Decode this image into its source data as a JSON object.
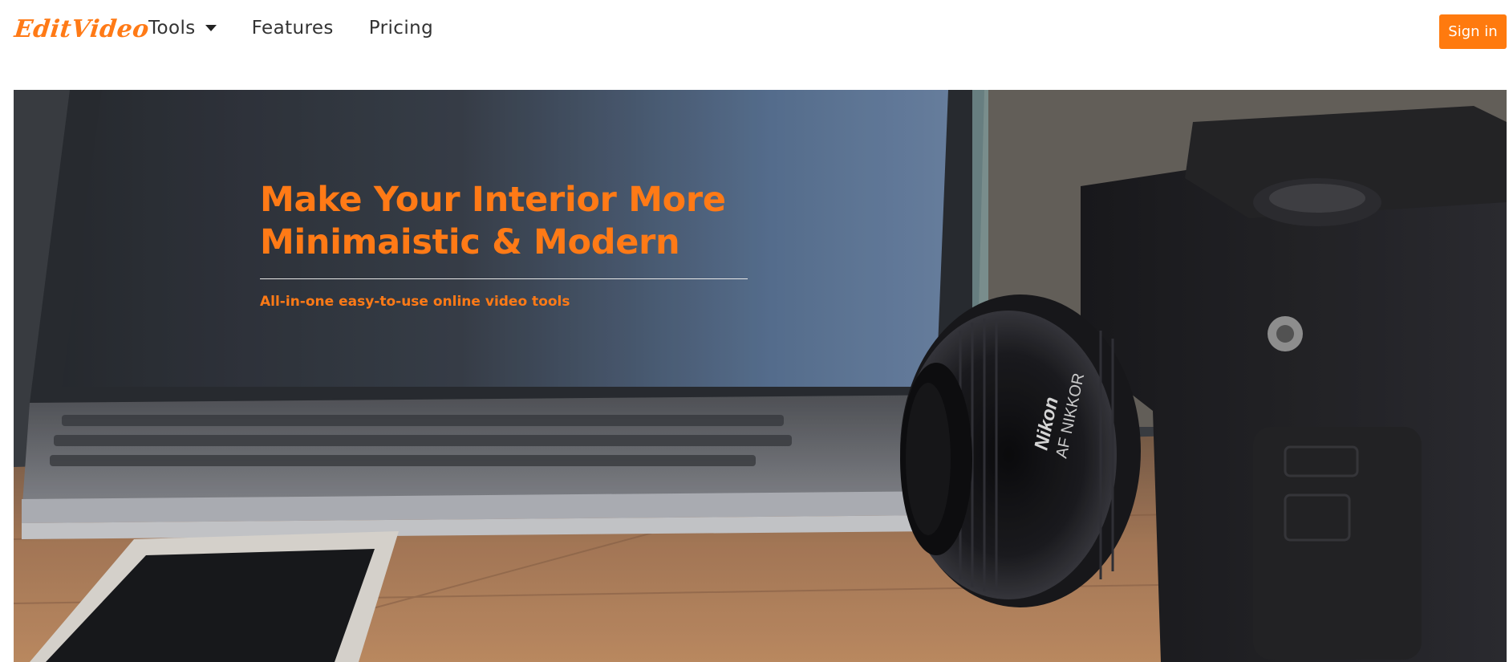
{
  "navbar": {
    "logo": "EditVideo",
    "links": [
      {
        "label": "Tools",
        "has_dropdown": true
      },
      {
        "label": "Features"
      },
      {
        "label": "Pricing"
      }
    ],
    "signin_label": "Sign in"
  },
  "hero": {
    "title_line1": "Make Your Interior More",
    "title_line2": "Minimaistic & Modern",
    "subtitle": "All-in-one easy-to-use online video tools",
    "camera_brand": "Nikon",
    "lens_label": "AF NIKKOR"
  },
  "colors": {
    "accent": "#ff7a16",
    "button": "#ff7a0e",
    "nav_text": "#333333"
  },
  "icons": {
    "dropdown": "caret-down-icon"
  }
}
